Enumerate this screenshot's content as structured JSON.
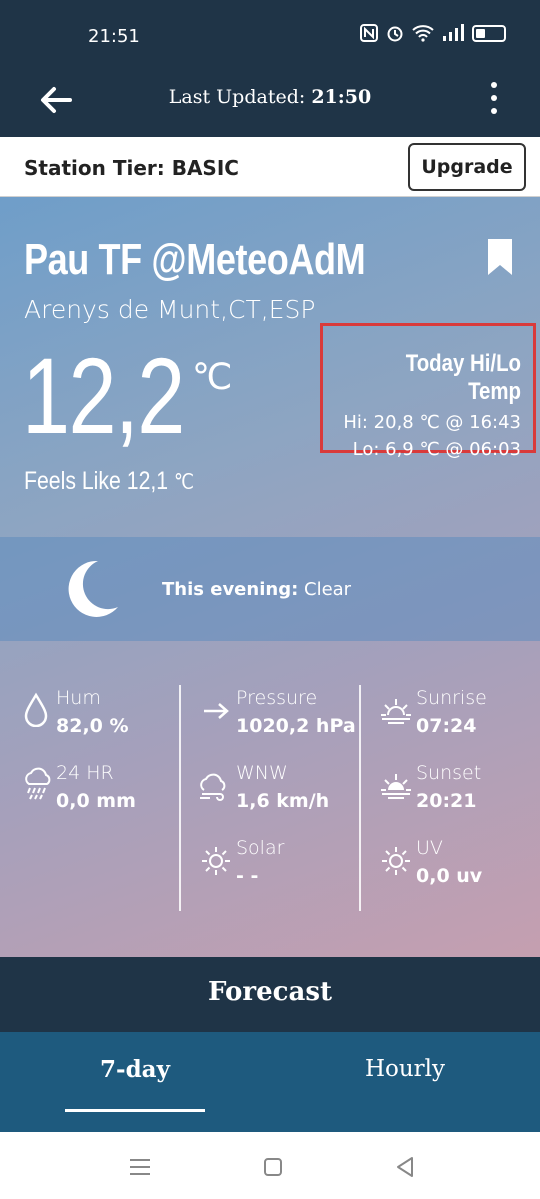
{
  "status_bar": {
    "time": "21:51",
    "nfc": "N",
    "alarm": "⏰",
    "wifi": "WiFi",
    "signal": "▂▄▆█"
  },
  "app_bar": {
    "title_prefix": "Last Updated: ",
    "title_time": "21:50"
  },
  "tier": {
    "label": "Station Tier: BASIC",
    "upgrade_label": "Upgrade"
  },
  "station": {
    "name": "Pau TF @MeteoAdM",
    "location": "Arenys de Munt,CT,ESP"
  },
  "current": {
    "temp": "12,2",
    "unit": "℃",
    "feels_like": "Feels Like 12,1",
    "feels_unit": "℃"
  },
  "hilo": {
    "title": "Today Hi/Lo Temp",
    "hi": "Hi: 20,8 ℃ @ 16:43",
    "lo": "Lo: 6,9 ℃ @ 06:03",
    "highlight_color": "#d93a3a"
  },
  "condition": {
    "label": "This evening:",
    "value": " Clear"
  },
  "stats": {
    "hum": {
      "label": "Hum",
      "value": "82,0 %"
    },
    "rain": {
      "label": "24 HR",
      "value": "0,0 mm"
    },
    "pressure": {
      "label": "Pressure",
      "value": "1020,2 hPa"
    },
    "wind": {
      "label": "WNW",
      "value": "1,6 km/h"
    },
    "solar": {
      "label": "Solar",
      "value": "- -"
    },
    "sunrise": {
      "label": "Sunrise",
      "value": "07:24"
    },
    "sunset": {
      "label": "Sunset",
      "value": "20:21"
    },
    "uv": {
      "label": "UV",
      "value": "0,0 uv"
    }
  },
  "forecast": {
    "title": "Forecast",
    "tabs": [
      "7-day",
      "Hourly"
    ],
    "active_tab": "7-day"
  },
  "colors": {
    "header": "#1f3447",
    "tabs": "#1e5a7e"
  }
}
